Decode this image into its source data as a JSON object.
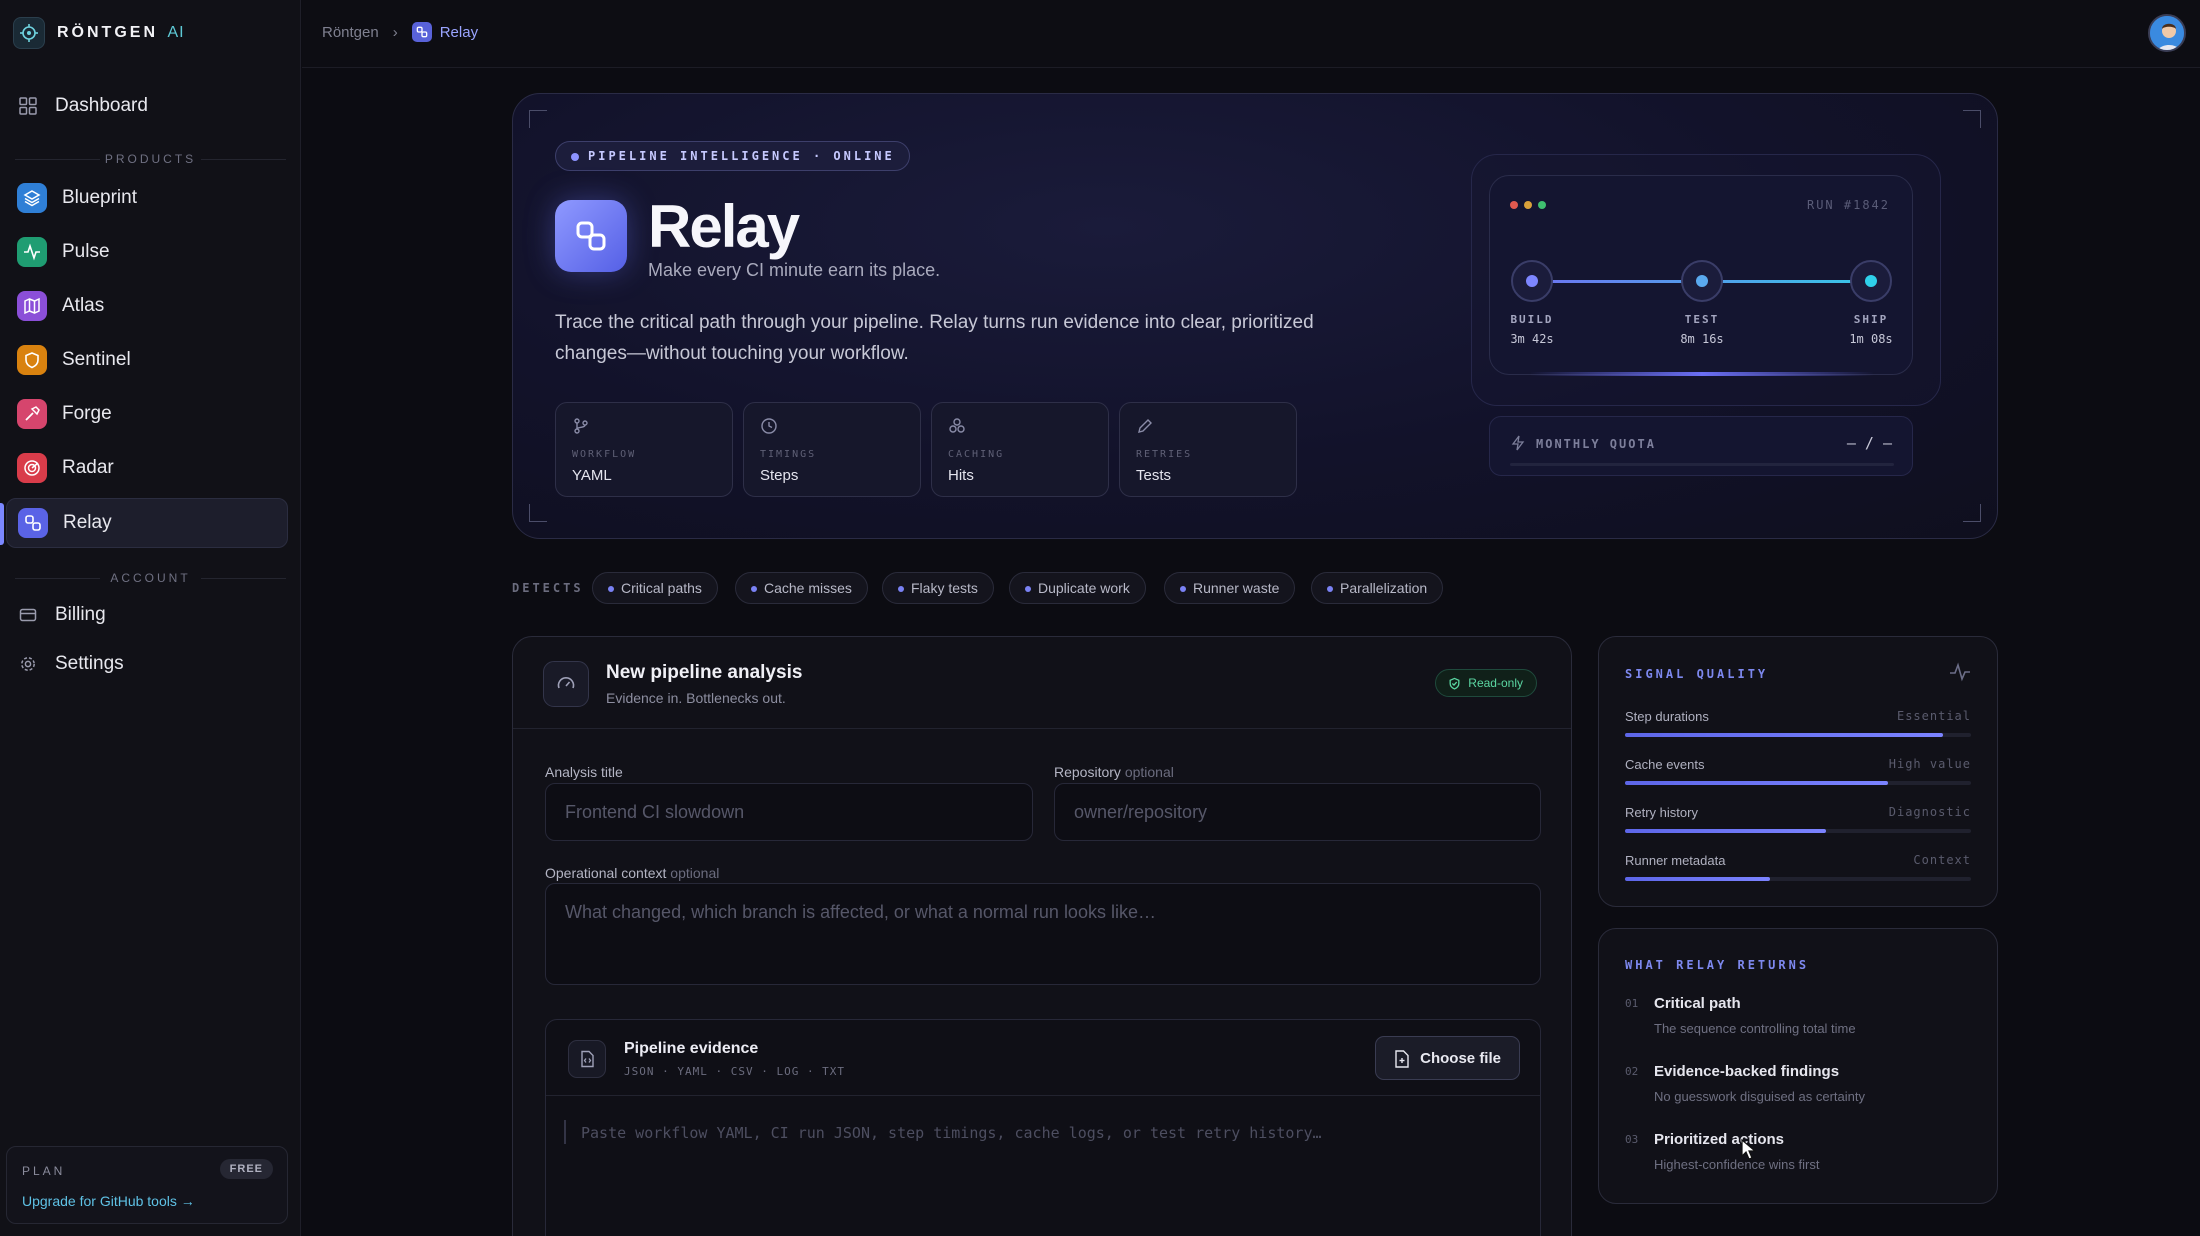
{
  "brand": {
    "name": "RÖNTGEN",
    "suffix": "AI"
  },
  "sidebar": {
    "dashboard": "Dashboard",
    "products_label": "PRODUCTS",
    "products": [
      {
        "label": "Blueprint",
        "color": "#2f7fd6",
        "icon": "layers-icon"
      },
      {
        "label": "Pulse",
        "color": "#1f9d72",
        "icon": "pulse-icon"
      },
      {
        "label": "Atlas",
        "color": "#8b4fd8",
        "icon": "map-icon"
      },
      {
        "label": "Sentinel",
        "color": "#d9820f",
        "icon": "shield-icon"
      },
      {
        "label": "Forge",
        "color": "#d6456d",
        "icon": "hammer-icon"
      },
      {
        "label": "Radar",
        "color": "#d93c4a",
        "icon": "radar-icon"
      },
      {
        "label": "Relay",
        "color": "#5a63e6",
        "icon": "relay-icon"
      }
    ],
    "account_label": "ACCOUNT",
    "billing": "Billing",
    "settings": "Settings",
    "plan": {
      "title": "PLAN",
      "badge": "FREE",
      "link": "Upgrade for GitHub tools →"
    }
  },
  "breadcrumb": {
    "root": "Röntgen",
    "current": "Relay"
  },
  "hero": {
    "pill": "PIPELINE INTELLIGENCE · ONLINE",
    "title": "Relay",
    "tagline": "Make every CI minute earn its place.",
    "description": "Trace the critical path through your pipeline. Relay turns run evidence into clear, prioritized changes—without touching your workflow.",
    "features": [
      {
        "label": "WORKFLOW",
        "value": "YAML",
        "icon": "branch-icon"
      },
      {
        "label": "TIMINGS",
        "value": "Steps",
        "icon": "clock-icon"
      },
      {
        "label": "CACHING",
        "value": "Hits",
        "icon": "cache-icon"
      },
      {
        "label": "RETRIES",
        "value": "Tests",
        "icon": "pen-icon"
      }
    ],
    "run": {
      "label": "RUN #1842",
      "stages": [
        {
          "name": "BUILD",
          "time": "3m 42s",
          "color": "#7d86ff"
        },
        {
          "name": "TEST",
          "time": "8m 16s",
          "color": "#5aa9ee"
        },
        {
          "name": "SHIP",
          "time": "1m 08s",
          "color": "#2fd0ea"
        }
      ]
    },
    "quota": {
      "label": "MONTHLY QUOTA",
      "value": "– / –"
    }
  },
  "detects": {
    "label": "DETECTS",
    "chips": [
      "Critical paths",
      "Cache misses",
      "Flaky tests",
      "Duplicate work",
      "Runner waste",
      "Parallelization"
    ]
  },
  "analysis": {
    "title": "New pipeline analysis",
    "subtitle": "Evidence in. Bottlenecks out.",
    "badge": "Read-only",
    "title_label": "Analysis title",
    "title_placeholder": "Frontend CI slowdown",
    "repo_label": "Repository",
    "repo_optional": "optional",
    "repo_placeholder": "owner/repository",
    "context_label": "Operational context",
    "context_optional": "optional",
    "context_placeholder": "What changed, which branch is affected, or what a normal run looks like…",
    "evidence": {
      "title": "Pipeline evidence",
      "types": "JSON · YAML · CSV · LOG · TXT",
      "choose": "Choose file",
      "placeholder": "Paste workflow YAML, CI run JSON, step timings, cache logs, or test retry history…"
    }
  },
  "signal": {
    "title": "SIGNAL QUALITY",
    "rows": [
      {
        "name": "Step durations",
        "tag": "Essential",
        "fill": 0.92
      },
      {
        "name": "Cache events",
        "tag": "High value",
        "fill": 0.76
      },
      {
        "name": "Retry history",
        "tag": "Diagnostic",
        "fill": 0.58
      },
      {
        "name": "Runner metadata",
        "tag": "Context",
        "fill": 0.42
      }
    ]
  },
  "returns": {
    "title": "WHAT RELAY RETURNS",
    "items": [
      {
        "num": "01",
        "title": "Critical path",
        "sub": "The sequence controlling total time"
      },
      {
        "num": "02",
        "title": "Evidence-backed findings",
        "sub": "No guesswork disguised as certainty"
      },
      {
        "num": "03",
        "title": "Prioritized actions",
        "sub": "Highest-confidence wins first"
      }
    ]
  }
}
